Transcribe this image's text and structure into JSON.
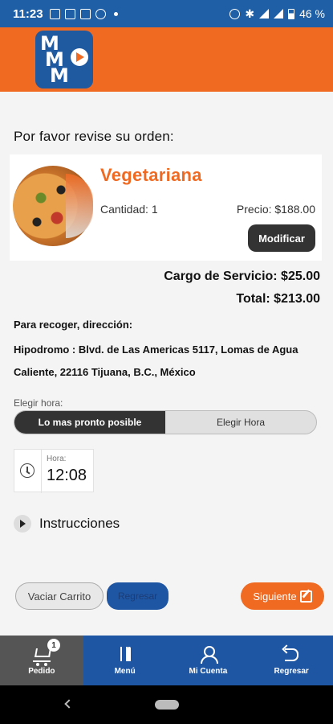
{
  "status_bar": {
    "time": "11:23",
    "battery": "46 %"
  },
  "order": {
    "review_title": "Por favor revise su orden:",
    "item": {
      "name": "Vegetariana",
      "quantity": "Cantidad: 1",
      "price": "Precio: $188.00",
      "modify_label": "Modificar"
    },
    "service_fee": "Cargo de Servicio: $25.00",
    "total": "Total: $213.00"
  },
  "pickup": {
    "label": "Para recoger, dirección:",
    "address": "Hipodromo : Blvd. de Las Americas 5117, Lomas de Agua Caliente, 22116 Tijuana, B.C., México"
  },
  "time_choice": {
    "label": "Elegir hora:",
    "options": [
      "Lo mas pronto posible",
      "Elegir Hora"
    ],
    "selected": "Lo mas pronto posible",
    "hora_label": "Hora:",
    "hora_value": "12:08"
  },
  "instructions": {
    "label": "Instrucciones"
  },
  "actions": {
    "clear_cart": "Vaciar Carrito",
    "back": "Regresar",
    "next": "Siguiente"
  },
  "bottom_nav": {
    "items": [
      {
        "label": "Pedido",
        "icon": "cart-icon",
        "badge": "1"
      },
      {
        "label": "Menú",
        "icon": "fork-knife-icon"
      },
      {
        "label": "Mi Cuenta",
        "icon": "user-icon"
      },
      {
        "label": "Regresar",
        "icon": "back-arrow-icon"
      }
    ]
  },
  "colors": {
    "primary_orange": "#f06a22",
    "primary_blue": "#1f56a3",
    "dark": "#333333"
  }
}
